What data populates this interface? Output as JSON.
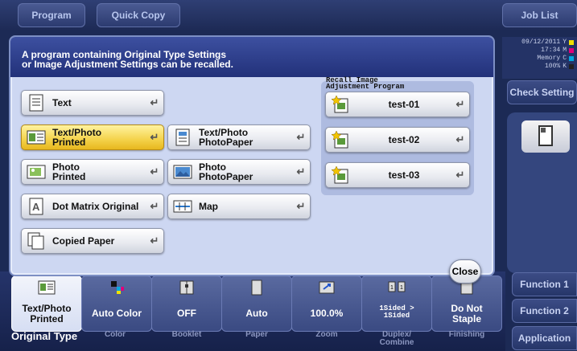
{
  "topbar": {
    "program": "Program",
    "quick_copy": "Quick Copy",
    "job_list": "Job List"
  },
  "status": {
    "date": "09/12/2011",
    "time": "17:34",
    "memory_label": "Memory",
    "memory": "100%",
    "inks": [
      "Y",
      "M",
      "C",
      "K"
    ],
    "ink_colors": [
      "#f0e000",
      "#e0007a",
      "#00a8e0",
      "#222222"
    ]
  },
  "side": {
    "check_setting": "Check Setting",
    "function1": "Function 1",
    "function2": "Function 2",
    "application": "Application"
  },
  "panel": {
    "message_line1": "A program containing Original Type Settings",
    "message_line2": "or Image Adjustment Settings can be recalled.",
    "options": {
      "text": "Text",
      "text_photo_printed_1": "Text/Photo",
      "text_photo_printed_2": "Printed",
      "text_photo_paper_1": "Text/Photo",
      "text_photo_paper_2": "PhotoPaper",
      "photo_printed_1": "Photo",
      "photo_printed_2": "Printed",
      "photo_paper_1": "Photo",
      "photo_paper_2": "PhotoPaper",
      "dot_matrix": "Dot Matrix Original",
      "map": "Map",
      "copied_paper": "Copied Paper"
    },
    "recall_title_1": "Recall Image",
    "recall_title_2": "Adjustment Program",
    "programs": [
      "test-01",
      "test-02",
      "test-03"
    ],
    "close": "Close",
    "enter_glyph": "↵"
  },
  "bottom": {
    "values": {
      "original_1": "Text/Photo",
      "original_2": "Printed",
      "color": "Auto Color",
      "booklet": "OFF",
      "paper": "Auto",
      "zoom": "100.0%",
      "duplex_1": "1Sided >",
      "duplex_2": "1Sided",
      "finishing_1": "Do Not",
      "finishing_2": "Staple"
    },
    "cats": {
      "original": "Original Type",
      "color": "Color",
      "booklet": "Booklet",
      "paper": "Paper",
      "zoom": "Zoom",
      "duplex_1": "Duplex/",
      "duplex_2": "Combine",
      "finishing": "Finishing"
    }
  },
  "colors": {
    "selected": "#f4d24a",
    "accent": "#22317a"
  }
}
